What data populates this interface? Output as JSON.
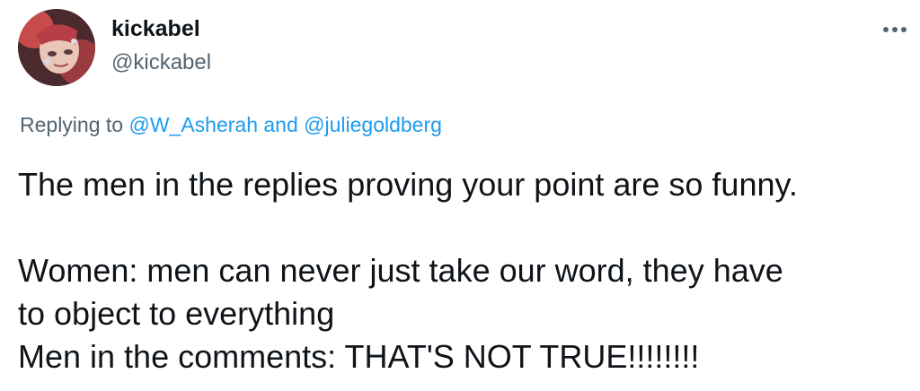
{
  "author": {
    "display_name": "kickabel",
    "handle": "@kickabel"
  },
  "icons": {
    "avatar": "profile-photo",
    "more": "more-horizontal-icon"
  },
  "reply_context": {
    "prefix": "Replying to",
    "mention_1": "@W_Asherah",
    "conjunction": "and",
    "mention_2": "@juliegoldberg"
  },
  "tweet": {
    "lines": [
      "The men in the replies proving your point are so funny.",
      "Women: men can never just take our word, they have",
      "to object to everything",
      "Men in the comments: THAT'S NOT TRUE!!!!!!!!"
    ]
  },
  "colors": {
    "text": "#0f1419",
    "secondary": "#536471",
    "link": "#1d9bf0"
  }
}
